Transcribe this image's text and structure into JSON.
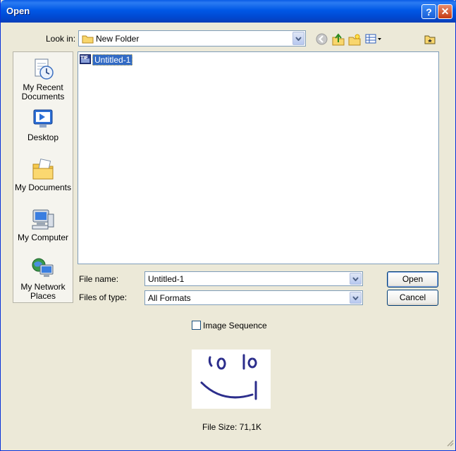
{
  "window": {
    "title": "Open"
  },
  "titlebar": {
    "help_icon": "help-icon",
    "close_icon": "close-icon"
  },
  "look_in": {
    "label": "Look in:",
    "value": "New Folder",
    "toolbar_icons": [
      "back-icon",
      "up-folder-icon",
      "new-folder-icon",
      "view-menu-icon"
    ],
    "extra_icon": "favorite-folder-icon"
  },
  "places": [
    {
      "label": "My Recent Documents",
      "icon": "recent-documents-icon"
    },
    {
      "label": "Desktop",
      "icon": "desktop-icon"
    },
    {
      "label": "My Documents",
      "icon": "my-documents-icon"
    },
    {
      "label": "My Computer",
      "icon": "my-computer-icon"
    },
    {
      "label": "My Network Places",
      "icon": "network-places-icon"
    }
  ],
  "files": [
    {
      "name": "Untitled-1",
      "type_badge": "TIF",
      "selected": true
    }
  ],
  "file_name": {
    "label": "File name:",
    "value": "Untitled-1"
  },
  "file_type": {
    "label": "Files of type:",
    "value": "All Formats"
  },
  "buttons": {
    "open": "Open",
    "cancel": "Cancel"
  },
  "image_sequence": {
    "label": "Image Sequence",
    "checked": false
  },
  "preview": {
    "file_size": "File Size: 71,1K"
  },
  "colors": {
    "title_blue": "#0058e6",
    "face": "#ece9d8",
    "selection": "#316ac5",
    "border_blue": "#7f9db9"
  }
}
